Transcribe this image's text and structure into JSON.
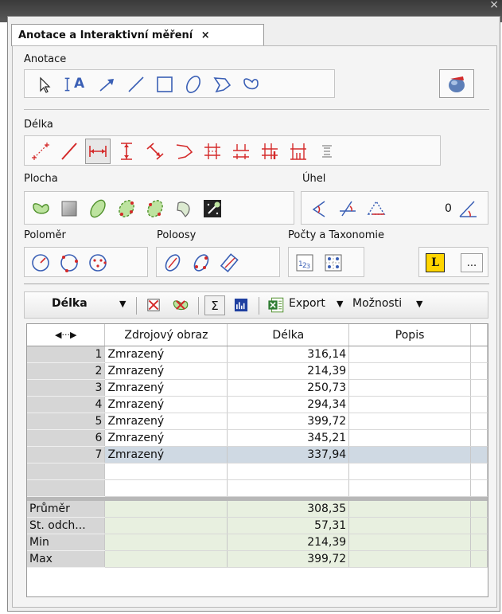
{
  "tab": {
    "title": "Anotace a Interaktivní měření",
    "close": "×"
  },
  "window_close": "×",
  "sections": {
    "anotace": "Anotace",
    "delka": "Délka",
    "plocha": "Plocha",
    "uhel": "Úhel",
    "polomer": "Poloměr",
    "poloosy": "Poloosy",
    "pocty": "Počty a Taxonomie"
  },
  "annotation_tools": [
    "pointer-icon",
    "text-icon",
    "arrow-icon",
    "line-icon",
    "rectangle-icon",
    "ellipse-icon",
    "polygon-icon",
    "freehand-icon"
  ],
  "angle_value": "0",
  "text_tool_label": "A",
  "legend_button_label": "L",
  "more_button_label": "...",
  "toolbar": {
    "measure_select": "Délka",
    "export_label": "Export",
    "options_label": "Možnosti"
  },
  "table": {
    "nav_label": "◀···▶",
    "headers": [
      "Zdrojový obraz",
      "Délka",
      "Popis"
    ],
    "rows": [
      {
        "n": "1",
        "source": "Zmrazený",
        "value": "316,14"
      },
      {
        "n": "2",
        "source": "Zmrazený",
        "value": "214,39"
      },
      {
        "n": "3",
        "source": "Zmrazený",
        "value": "250,73"
      },
      {
        "n": "4",
        "source": "Zmrazený",
        "value": "294,34"
      },
      {
        "n": "5",
        "source": "Zmrazený",
        "value": "399,72"
      },
      {
        "n": "6",
        "source": "Zmrazený",
        "value": "345,21"
      },
      {
        "n": "7",
        "source": "Zmrazený",
        "value": "337,94"
      }
    ],
    "stats": [
      {
        "label": "Průměr",
        "value": "308,35"
      },
      {
        "label": "St. odch...",
        "value": "57,31"
      },
      {
        "label": "Min",
        "value": "214,39"
      },
      {
        "label": "Max",
        "value": "399,72"
      }
    ]
  },
  "colors": {
    "accent_blue": "#3a5fb5",
    "measure_red": "#d42a2a",
    "area_green": "#4e8f2a"
  }
}
